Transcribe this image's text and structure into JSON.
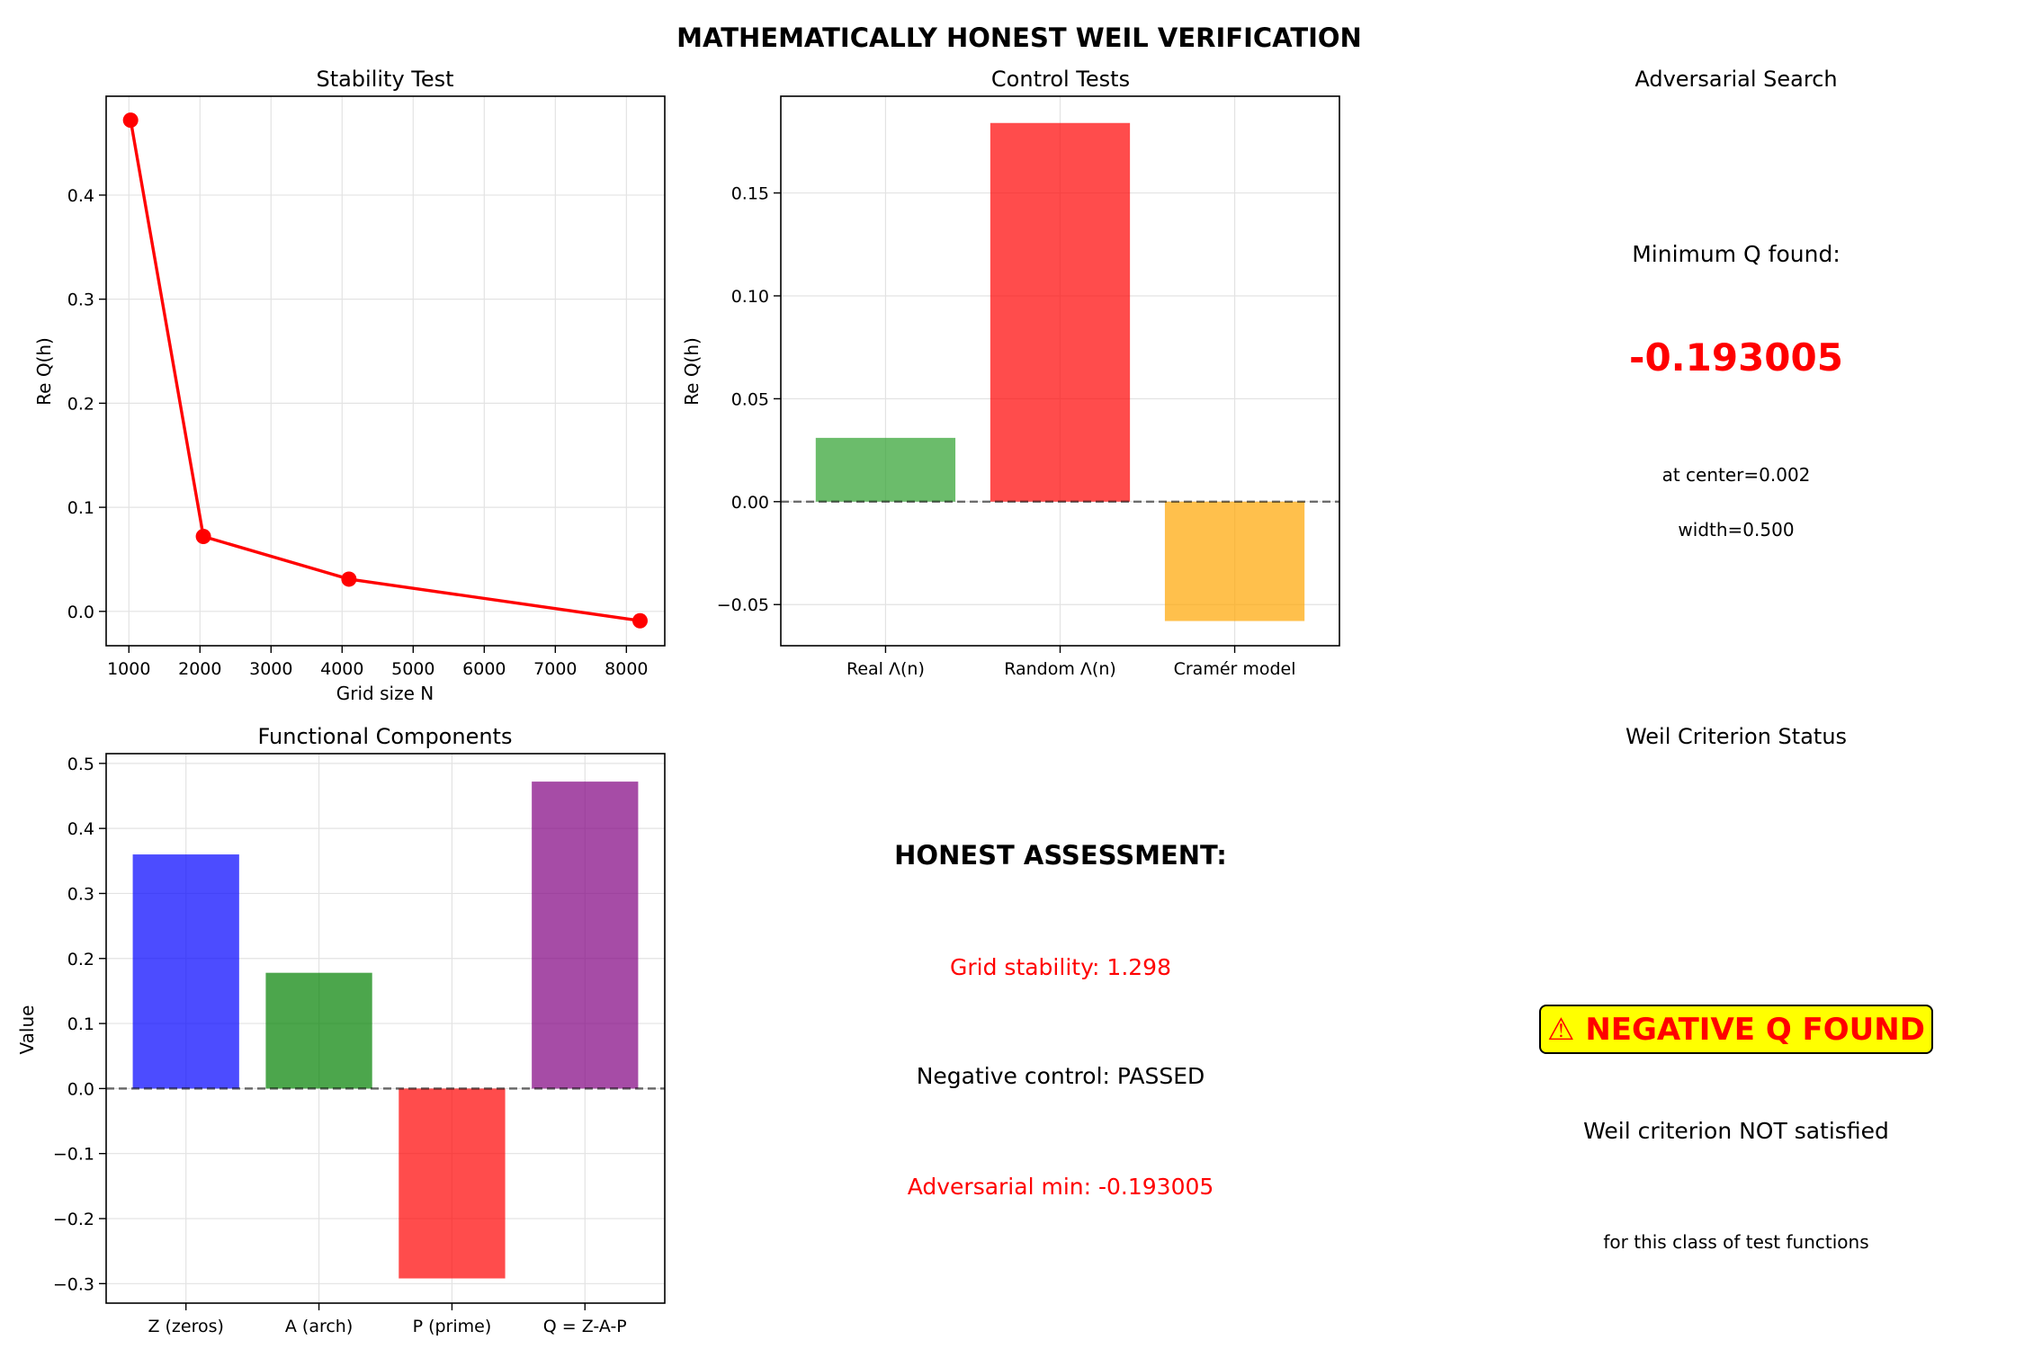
{
  "suptitle": "MATHEMATICALLY HONEST WEIL VERIFICATION",
  "colors": {
    "line": "#ff0000",
    "real": "#2ca02c",
    "random": "#ff0000",
    "cramer": "#ffa500",
    "zeros": "#0000ff",
    "arch": "#008000",
    "prime": "#ff0000",
    "q": "#800080",
    "warn_bg": "#ffff00",
    "warn_text": "#ff0000"
  },
  "chart_data": [
    {
      "type": "line",
      "title": "Stability Test",
      "xlabel": "Grid size N",
      "ylabel": "Re Q(h)",
      "x": [
        1024,
        2048,
        4096,
        8192
      ],
      "y": [
        0.472,
        0.072,
        0.031,
        -0.009
      ],
      "xlim": [
        680,
        8540
      ],
      "ylim": [
        -0.033,
        0.495
      ],
      "xticks": [
        1000,
        2000,
        3000,
        4000,
        5000,
        6000,
        7000,
        8000
      ],
      "yticks": [
        0.0,
        0.1,
        0.2,
        0.3,
        0.4
      ],
      "ytick_labels": [
        "0.0",
        "0.1",
        "0.2",
        "0.3",
        "0.4"
      ],
      "grid": true
    },
    {
      "type": "bar",
      "title": "Control Tests",
      "xlabel": "",
      "ylabel": "Re Q(h)",
      "categories": [
        "Real Λ(n)",
        "Random Λ(n)",
        "Cramér model"
      ],
      "values": [
        0.031,
        0.184,
        -0.058
      ],
      "colors": [
        "#2ca02c",
        "#ff0000",
        "#ffa500"
      ],
      "ylim": [
        -0.07,
        0.197
      ],
      "yticks": [
        -0.05,
        0.0,
        0.05,
        0.1,
        0.15
      ],
      "ytick_labels": [
        "−0.05",
        "0.00",
        "0.05",
        "0.10",
        "0.15"
      ],
      "zero_line": true,
      "grid": true
    },
    {
      "type": "bar",
      "title": "Functional Components",
      "xlabel": "",
      "ylabel": "Value",
      "categories": [
        "Z (zeros)",
        "A (arch)",
        "P (prime)",
        "Q = Z-A-P"
      ],
      "values": [
        0.36,
        0.178,
        -0.292,
        0.472
      ],
      "colors": [
        "#0000ff",
        "#008000",
        "#ff0000",
        "#800080"
      ],
      "ylim": [
        -0.33,
        0.515
      ],
      "yticks": [
        -0.3,
        -0.2,
        -0.1,
        0.0,
        0.1,
        0.2,
        0.3,
        0.4,
        0.5
      ],
      "ytick_labels": [
        "−0.3",
        "−0.2",
        "−0.1",
        "0.0",
        "0.1",
        "0.2",
        "0.3",
        "0.4",
        "0.5"
      ],
      "zero_line": true,
      "grid": true
    }
  ],
  "adversarial": {
    "title": "Adversarial Search",
    "label": "Minimum Q found:",
    "value": "-0.193005",
    "center": "at center=0.002",
    "width": "width=0.500"
  },
  "assessment": {
    "heading": "HONEST ASSESSMENT:",
    "grid_stability": "Grid stability: 1.298",
    "negative_control": "Negative control: PASSED",
    "adversarial_min": "Adversarial min: -0.193005"
  },
  "status": {
    "title": "Weil Criterion Status",
    "badge": "⚠ NEGATIVE Q FOUND",
    "line1": "Weil criterion NOT satisfied",
    "line2": "for this class of test functions"
  }
}
